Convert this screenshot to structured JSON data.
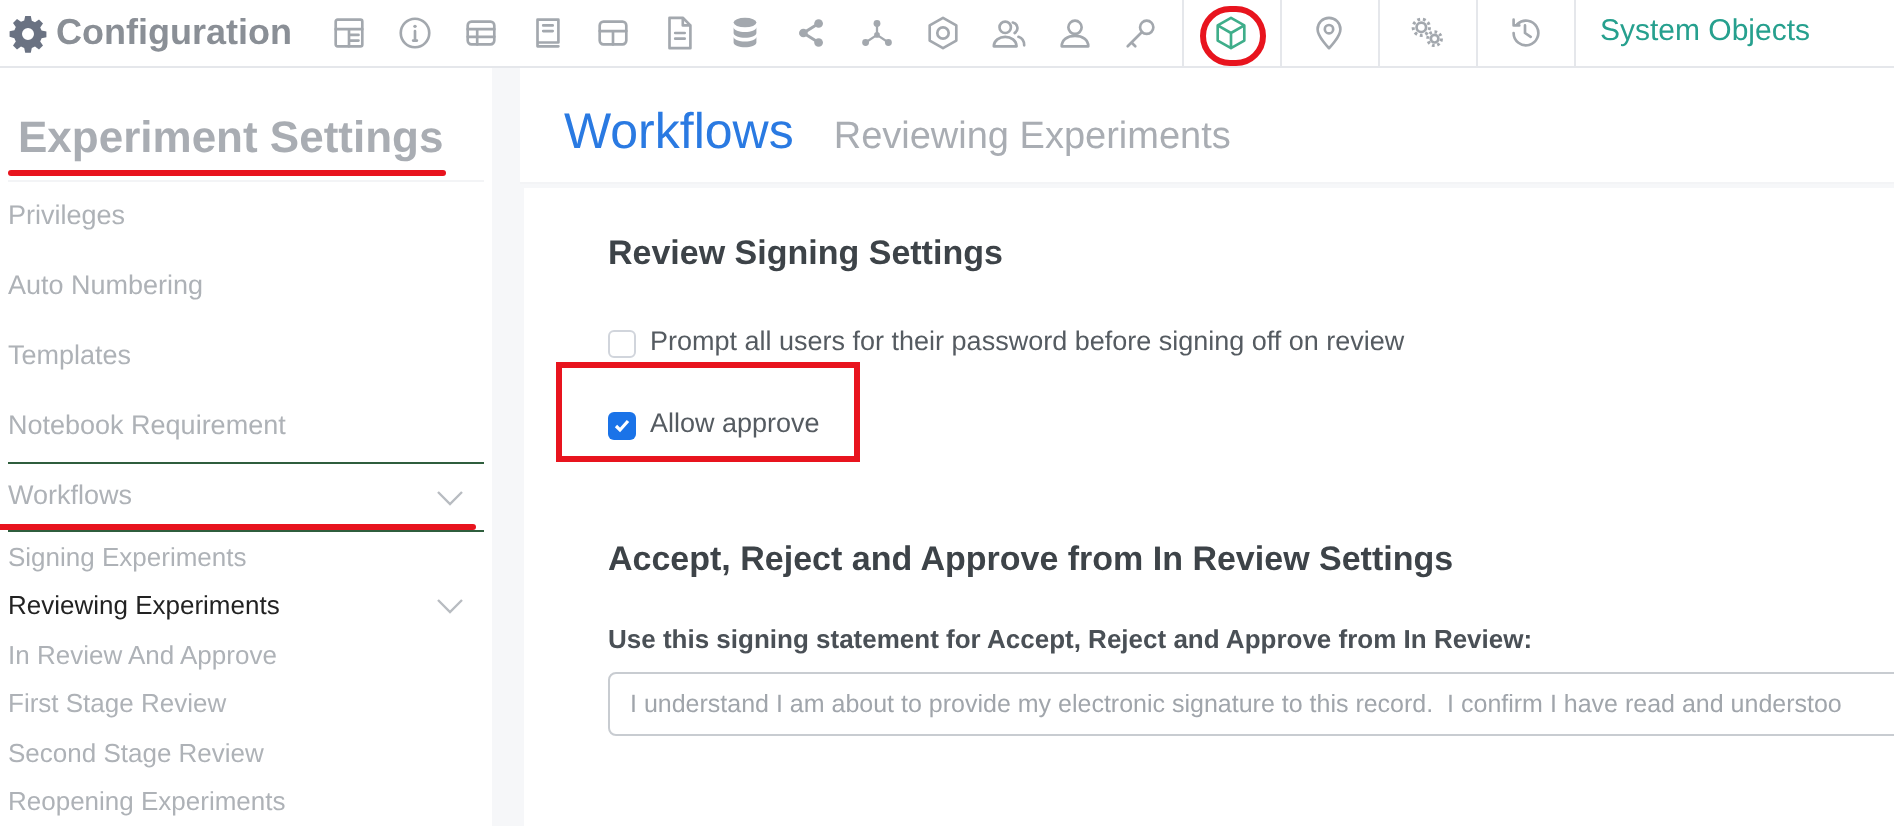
{
  "toolbar": {
    "title": "Configuration",
    "icons": [
      {
        "selected": false,
        "circled": false
      },
      {
        "selected": false,
        "circled": false
      },
      {
        "selected": false,
        "circled": false
      },
      {
        "selected": false,
        "circled": false
      },
      {
        "selected": false,
        "circled": false
      },
      {
        "selected": false,
        "circled": false
      },
      {
        "selected": false,
        "circled": false
      },
      {
        "selected": false,
        "circled": false
      },
      {
        "selected": false,
        "circled": false
      },
      {
        "selected": false,
        "circled": false
      },
      {
        "selected": false,
        "circled": false
      },
      {
        "selected": false,
        "circled": false
      },
      {
        "selected": false,
        "circled": false
      },
      {
        "selected": true,
        "circled": true
      },
      {
        "selected": false,
        "circled": false
      },
      {
        "selected": false,
        "circled": false
      },
      {
        "selected": false,
        "circled": false
      }
    ],
    "link": "System Objects"
  },
  "sidebar": {
    "title": "Experiment Settings",
    "title_underlined": true,
    "items": [
      {
        "label": "Privileges",
        "selected": false,
        "underlined": false
      },
      {
        "label": "Auto Numbering",
        "selected": false,
        "underlined": false
      },
      {
        "label": "Templates",
        "selected": false,
        "underlined": false
      },
      {
        "label": "Notebook Requirement",
        "selected": false,
        "underlined": false
      },
      {
        "label": "Workflows",
        "selected": false,
        "underlined": true,
        "expanded": true,
        "children": [
          {
            "label": "Signing Experiments",
            "selected": false
          },
          {
            "label": "Reviewing Experiments",
            "selected": true,
            "expanded": true,
            "children": [
              {
                "label": "In Review And Approve",
                "selected": false
              },
              {
                "label": "First Stage Review",
                "selected": false
              },
              {
                "label": "Second Stage Review",
                "selected": false
              }
            ]
          },
          {
            "label": "Reopening Experiments",
            "selected": false
          }
        ]
      }
    ]
  },
  "header": {
    "title": "Workflows",
    "subtitle": "Reviewing Experiments"
  },
  "sections": [
    {
      "title": "Review Signing Settings",
      "options": [
        {
          "label": "Prompt all users for their password before signing off on review",
          "checked": false,
          "boxed": false
        },
        {
          "label": "Allow approve",
          "checked": true,
          "boxed": true
        }
      ]
    },
    {
      "title": "Accept, Reject and Approve from In Review Settings",
      "field": {
        "label": "Use this signing statement for Accept, Reject and Approve from In Review:",
        "value": "I understand I am about to provide my electronic signature to this record.  I confirm I have read and understoo"
      }
    }
  ]
}
